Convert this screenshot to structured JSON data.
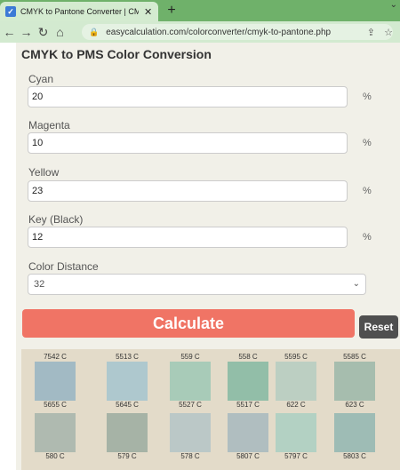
{
  "browser": {
    "tab_title": "CMYK to Pantone Converter | CM",
    "url": "easycalculation.com/colorconverter/cmyk-to-pantone.php"
  },
  "page": {
    "heading": "CMYK to PMS Color Conversion",
    "fields": [
      {
        "label": "Cyan",
        "value": "20",
        "unit": "%"
      },
      {
        "label": "Magenta",
        "value": "10",
        "unit": "%"
      },
      {
        "label": "Yellow",
        "value": "23",
        "unit": "%"
      },
      {
        "label": "Key (Black)",
        "value": "12",
        "unit": "%"
      }
    ],
    "distance": {
      "label": "Color Distance",
      "value": "32"
    },
    "calculate_label": "Calculate",
    "reset_label": "Reset"
  },
  "results": {
    "row1": [
      {
        "top": "7542 C",
        "bottom": "5655 C",
        "color": "#a2bac4"
      },
      {
        "top": "5513 C",
        "bottom": "5645 C",
        "color": "#aec8ce"
      },
      {
        "top": "559 C",
        "bottom": "5527 C",
        "color": "#a8cbb8"
      },
      {
        "top": "558 C",
        "bottom": "5517 C",
        "color": "#92bea8"
      },
      {
        "top": "5595 C",
        "bottom": "622 C",
        "color": "#bccfc2"
      },
      {
        "top": "5585 C",
        "bottom": "623 C",
        "color": "#a6bdae"
      }
    ],
    "row2": [
      {
        "bottom": "580 C",
        "color": "#afbab0"
      },
      {
        "bottom": "579 C",
        "color": "#a6b3a6"
      },
      {
        "bottom": "578 C",
        "color": "#bbc8c7"
      },
      {
        "bottom": "5807 C",
        "color": "#b0bec0"
      },
      {
        "bottom": "5797 C",
        "color": "#b3d1c3"
      },
      {
        "bottom": "5803 C",
        "color": "#9ebcb5"
      }
    ]
  }
}
